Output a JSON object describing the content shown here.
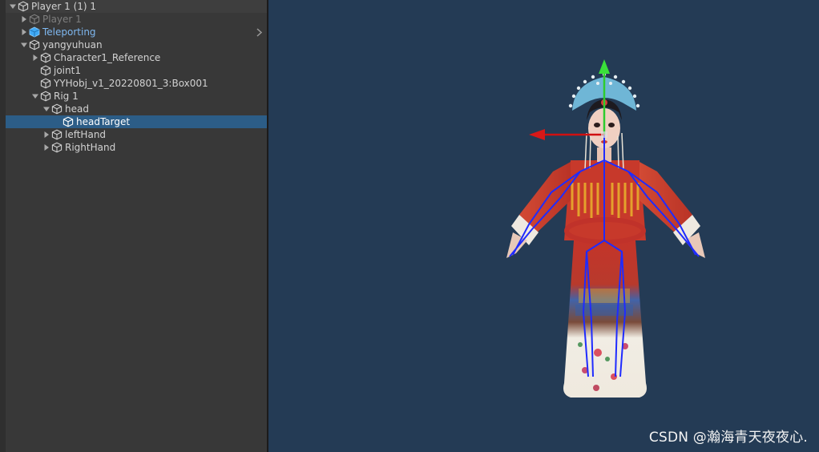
{
  "hierarchy": {
    "rows": [
      {
        "label": "Player 1 (1) 1",
        "depth": 0,
        "expanded": true,
        "has_children": true,
        "state": "normal",
        "icon": "gameobject-cube-icon"
      },
      {
        "label": "Player 1",
        "depth": 1,
        "expanded": false,
        "has_children": true,
        "state": "disabled",
        "icon": "gameobject-cube-icon"
      },
      {
        "label": "Teleporting",
        "depth": 1,
        "expanded": false,
        "has_children": true,
        "state": "prefab",
        "icon": "prefab-cube-icon"
      },
      {
        "label": "yangyuhuan",
        "depth": 1,
        "expanded": true,
        "has_children": true,
        "state": "normal",
        "icon": "gameobject-cube-icon"
      },
      {
        "label": "Character1_Reference",
        "depth": 2,
        "expanded": false,
        "has_children": true,
        "state": "normal",
        "icon": "gameobject-cube-icon"
      },
      {
        "label": "joint1",
        "depth": 2,
        "expanded": false,
        "has_children": false,
        "state": "normal",
        "icon": "gameobject-cube-icon"
      },
      {
        "label": "YYHobj_v1_20220801_3:Box001",
        "depth": 2,
        "expanded": false,
        "has_children": false,
        "state": "normal",
        "icon": "gameobject-cube-icon"
      },
      {
        "label": "Rig 1",
        "depth": 2,
        "expanded": true,
        "has_children": true,
        "state": "normal",
        "icon": "gameobject-cube-icon"
      },
      {
        "label": "head",
        "depth": 3,
        "expanded": true,
        "has_children": true,
        "state": "normal",
        "icon": "gameobject-cube-icon"
      },
      {
        "label": "headTarget",
        "depth": 4,
        "expanded": false,
        "has_children": false,
        "state": "selected",
        "icon": "gameobject-cube-icon"
      },
      {
        "label": "leftHand",
        "depth": 3,
        "expanded": false,
        "has_children": true,
        "state": "normal",
        "icon": "gameobject-cube-icon"
      },
      {
        "label": "RightHand",
        "depth": 3,
        "expanded": false,
        "has_children": true,
        "state": "normal",
        "icon": "gameobject-cube-icon"
      }
    ]
  },
  "scene": {
    "background_color": "#243b55",
    "gizmo": {
      "y_axis_color": "#2ecc2e",
      "x_axis_color": "#d01010",
      "bone_color": "#1f2bff"
    },
    "character_icon": "peking-opera-character-model"
  },
  "watermark": {
    "text": "CSDN @瀚海青天夜夜心."
  },
  "colors": {
    "panel": "#383838",
    "selection": "#2c5d87",
    "prefab_text": "#7fb8f0",
    "disabled_text": "#7e7e7e"
  }
}
